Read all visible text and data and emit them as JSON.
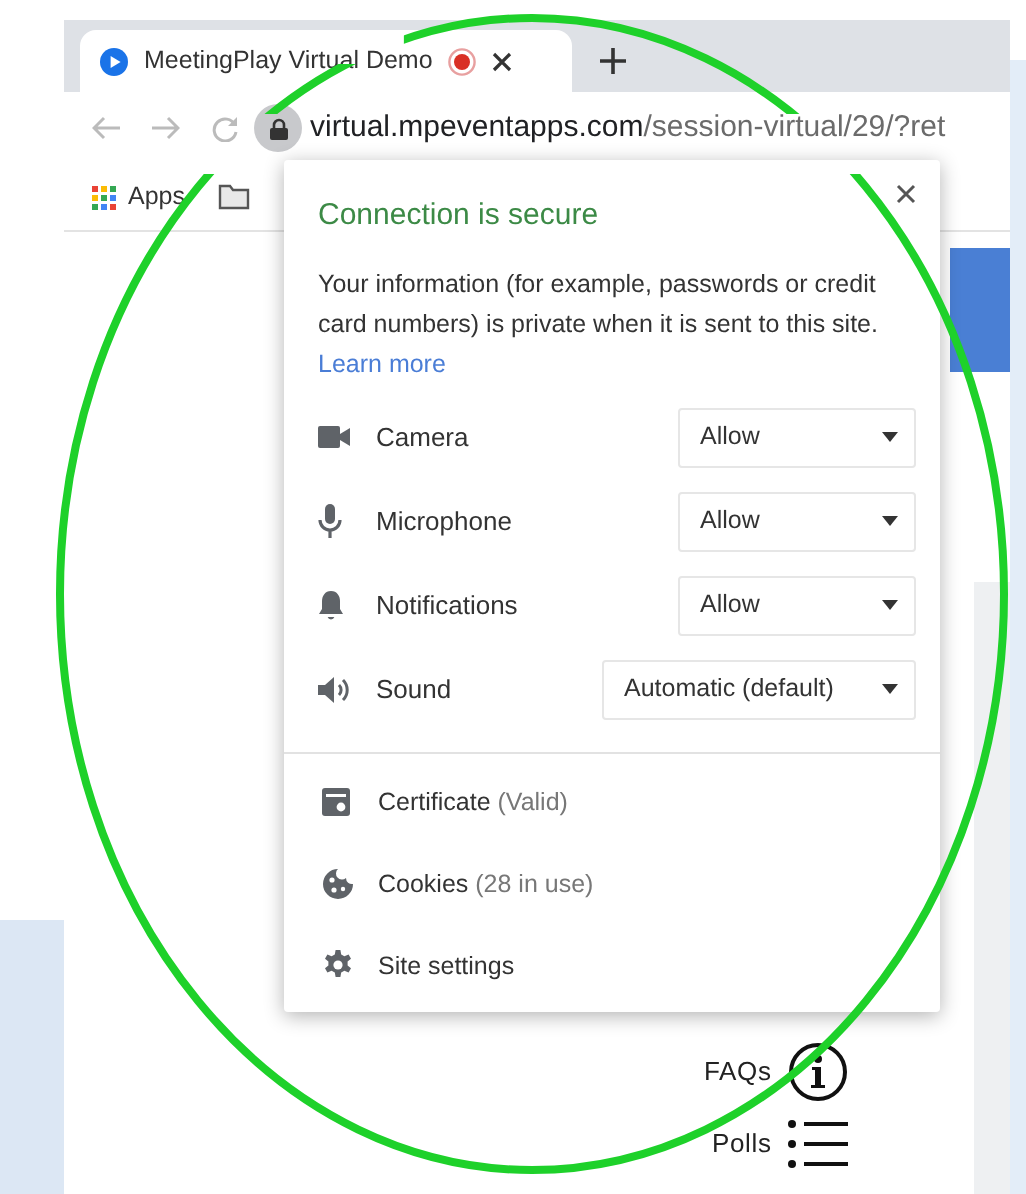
{
  "browser": {
    "tab": {
      "title": "MeetingPlay Virtual Demo",
      "recording": true,
      "selected": true
    },
    "address": "virtual.mpeventapps.com",
    "address_path": "/session-virtual/29/?ret",
    "bookmarks": [
      {
        "label": "Apps"
      }
    ]
  },
  "popup": {
    "title": "Connection is secure",
    "message": "Your information (for example, passwords or credit card numbers) is private when it is sent to this site.",
    "link": "Learn more",
    "permissions": [
      {
        "label": "Camera",
        "value": "Allow"
      },
      {
        "label": "Microphone",
        "value": "Allow"
      },
      {
        "label": "Notifications",
        "value": "Allow"
      },
      {
        "label": "Sound",
        "value": "Automatic (default)"
      }
    ],
    "items": [
      {
        "label": "Certificate",
        "detail": "(Valid)"
      },
      {
        "label": "Cookies",
        "detail": "(28 in use)"
      },
      {
        "label": "Site settings"
      }
    ]
  },
  "page": {
    "links": [
      {
        "label": "FAQs"
      },
      {
        "label": "Polls"
      }
    ]
  }
}
